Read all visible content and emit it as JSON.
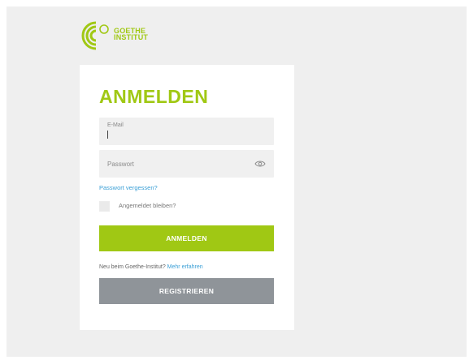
{
  "logo": {
    "line1": "GOETHE",
    "line2": "INSTITUT"
  },
  "login": {
    "title": "ANMELDEN",
    "email_label": "E-Mail",
    "password_placeholder": "Passwort",
    "forgot_link": "Passwort vergessen?",
    "remember_label": "Angemeldet bleiben?",
    "submit_label": "ANMELDEN"
  },
  "register": {
    "prompt": "Neu beim Goethe-Institut?",
    "more_link": "Mehr erfahren",
    "button_label": "REGISTRIEREN"
  },
  "colors": {
    "brand_green": "#a0c814",
    "link_blue": "#3a9fd6",
    "register_gray": "#8f9499"
  }
}
